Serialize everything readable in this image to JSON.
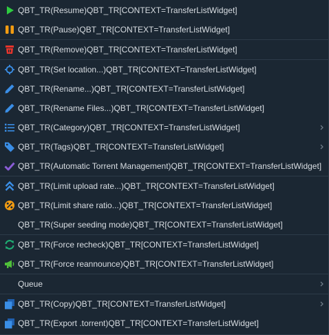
{
  "menu": {
    "items": [
      {
        "label": "QBT_TR(Resume)QBT_TR[CONTEXT=TransferListWidget]",
        "icon": "play-icon"
      },
      {
        "label": "QBT_TR(Pause)QBT_TR[CONTEXT=TransferListWidget]",
        "icon": "pause-icon"
      },
      {
        "label": "QBT_TR(Remove)QBT_TR[CONTEXT=TransferListWidget]",
        "icon": "trash-icon"
      },
      {
        "label": "QBT_TR(Set location...)QBT_TR[CONTEXT=TransferListWidget]",
        "icon": "crosshair-icon"
      },
      {
        "label": "QBT_TR(Rename...)QBT_TR[CONTEXT=TransferListWidget]",
        "icon": "pencil-icon"
      },
      {
        "label": "QBT_TR(Rename Files...)QBT_TR[CONTEXT=TransferListWidget]",
        "icon": "pencil-icon"
      },
      {
        "label": "QBT_TR(Category)QBT_TR[CONTEXT=TransferListWidget]",
        "icon": "list-icon"
      },
      {
        "label": "QBT_TR(Tags)QBT_TR[CONTEXT=TransferListWidget]",
        "icon": "tag-icon"
      },
      {
        "label": "QBT_TR(Automatic Torrent Management)QBT_TR[CONTEXT=TransferListWidget]",
        "icon": "checkmark-icon"
      },
      {
        "label": "QBT_TR(Limit upload rate...)QBT_TR[CONTEXT=TransferListWidget]",
        "icon": "double-chevron-up-icon"
      },
      {
        "label": "QBT_TR(Limit share ratio...)QBT_TR[CONTEXT=TransferListWidget]",
        "icon": "ratio-icon"
      },
      {
        "label": "QBT_TR(Super seeding mode)QBT_TR[CONTEXT=TransferListWidget]",
        "icon": ""
      },
      {
        "label": "QBT_TR(Force recheck)QBT_TR[CONTEXT=TransferListWidget]",
        "icon": "refresh-icon"
      },
      {
        "label": "QBT_TR(Force reannounce)QBT_TR[CONTEXT=TransferListWidget]",
        "icon": "megaphone-icon"
      },
      {
        "label": "Queue",
        "icon": ""
      },
      {
        "label": "QBT_TR(Copy)QBT_TR[CONTEXT=TransferListWidget]",
        "icon": "copy-icon"
      },
      {
        "label": "QBT_TR(Export .torrent)QBT_TR[CONTEXT=TransferListWidget]",
        "icon": "export-icon"
      }
    ],
    "submenu_arrow_icon": "chevron-right-icon"
  },
  "colors": {
    "background": "#1b2733",
    "text": "#d8dde2",
    "separator": "#2d3b49",
    "play": "#2ecc40",
    "pause": "#f39c12",
    "trash": "#e8352c",
    "accent_blue": "#3a8ee6",
    "check_purple": "#8a5cd6",
    "refresh_green": "#1fae73",
    "megaphone_green": "#4fbf3a",
    "ratio_orange": "#f39c12"
  }
}
